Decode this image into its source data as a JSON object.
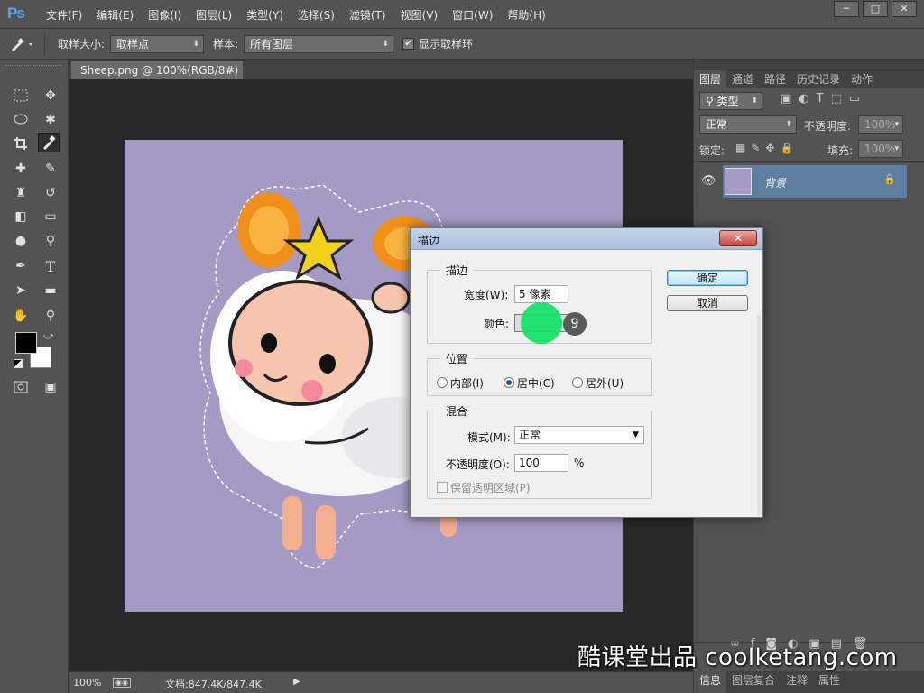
{
  "app": {
    "logo": "Ps"
  },
  "menu": [
    "文件(F)",
    "编辑(E)",
    "图像(I)",
    "图层(L)",
    "类型(Y)",
    "选择(S)",
    "滤镜(T)",
    "视图(V)",
    "窗口(W)",
    "帮助(H)"
  ],
  "window_controls": {
    "minimize": "─",
    "restore": "□",
    "close": "✕"
  },
  "options": {
    "sample_size_label": "取样大小:",
    "sample_size_value": "取样点",
    "sample_label": "样本:",
    "sample_value": "所有图层",
    "show_ring_label": "显示取样环"
  },
  "document": {
    "tab_title": "Sheep.png @ 100%(RGB/8#) *",
    "tab_close": "×",
    "canvas_color": "#a59ac4"
  },
  "status": {
    "zoom": "100%",
    "doc_info": "文档:847.4K/847.4K"
  },
  "panels": {
    "tabs": [
      "图层",
      "通道",
      "路径",
      "历史记录",
      "动作"
    ],
    "filter_kind": "类型",
    "blend_mode": "正常",
    "opacity_label": "不透明度:",
    "opacity_value": "100%",
    "lock_label": "锁定:",
    "fill_label": "填充:",
    "fill_value": "100%",
    "layer_name": "背景",
    "bottom_tabs": [
      "信息",
      "图层复合",
      "注释",
      "属性"
    ]
  },
  "dialog": {
    "title": "描边",
    "stroke_group": "描边",
    "width_label": "宽度(W):",
    "width_value": "5 像素",
    "color_label": "颜色:",
    "step_badge": "9",
    "position_group": "位置",
    "inside_label": "内部(I)",
    "center_label": "居中(C)",
    "outside_label": "居外(U)",
    "blend_group": "混合",
    "mode_label": "模式(M):",
    "mode_value": "正常",
    "opacity_label": "不透明度(O):",
    "opacity_value": "100",
    "opacity_unit": "%",
    "preserve_label": "保留透明区域(P)",
    "ok_label": "确定",
    "cancel_label": "取消",
    "close_glyph": "✕"
  },
  "watermark": "酷课堂出品 coolketang.com",
  "colors": {
    "accent": "#5aa7f0",
    "highlight": "#18e06a",
    "layer_selected": "#5e7ea0"
  }
}
